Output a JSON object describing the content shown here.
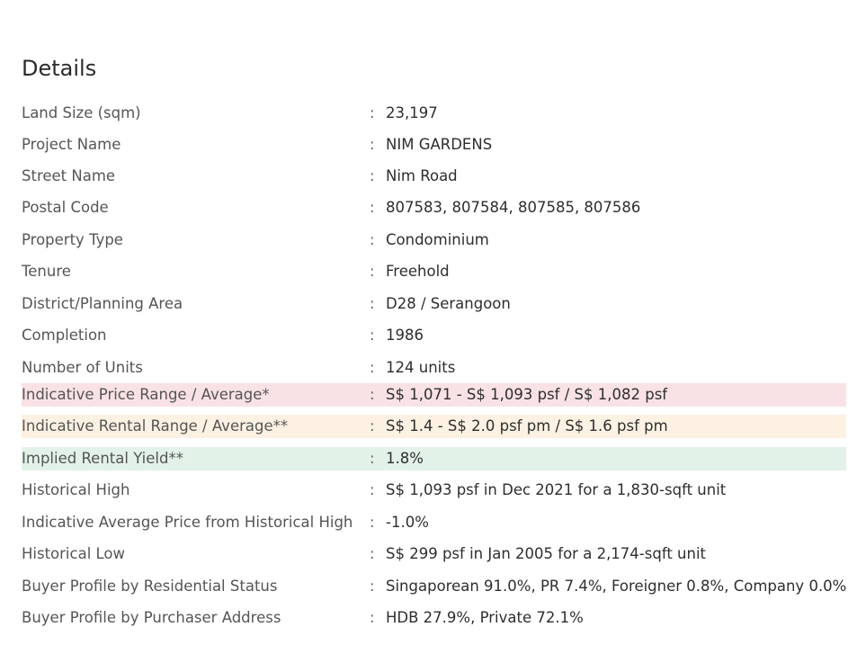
{
  "section": {
    "title": "Details"
  },
  "rows": [
    {
      "label": "Land Size (sqm)",
      "value": "23,197"
    },
    {
      "label": "Project Name",
      "value": "NIM GARDENS"
    },
    {
      "label": "Street Name",
      "value": "Nim Road"
    },
    {
      "label": "Postal Code",
      "value": "807583, 807584, 807585, 807586"
    },
    {
      "label": "Property Type",
      "value": "Condominium"
    },
    {
      "label": "Tenure",
      "value": "Freehold"
    },
    {
      "label": "District/Planning Area",
      "value": "D28 / Serangoon"
    },
    {
      "label": "Completion",
      "value": "1986"
    },
    {
      "label": "Number of Units",
      "value": "124 units"
    },
    {
      "label": "Indicative Price Range / Average*",
      "value": "S$ 1,071 - S$ 1,093 psf / S$ 1,082 psf",
      "highlight": "#f9e2e5"
    },
    {
      "label": "Indicative Rental Range / Average**",
      "value": "S$ 1.4 - S$ 2.0 psf pm / S$ 1.6 psf pm",
      "highlight": "#fcf1e2"
    },
    {
      "label": "Implied Rental Yield**",
      "value": "1.8%",
      "highlight": "#e3f2e9"
    },
    {
      "label": "Historical High",
      "value": "S$ 1,093 psf in Dec 2021 for a 1,830-sqft unit"
    },
    {
      "label": "Indicative Average Price from Historical High",
      "value": "-1.0%"
    },
    {
      "label": "Historical Low",
      "value": "S$ 299 psf in Jan 2005 for a 2,174-sqft unit"
    },
    {
      "label": "Buyer Profile by Residential Status",
      "value": "Singaporean 91.0%, PR 7.4%, Foreigner 0.8%, Company 0.0%"
    },
    {
      "label": "Buyer Profile by Purchaser Address",
      "value": "HDB 27.9%, Private 72.1%"
    }
  ],
  "separator": ":"
}
